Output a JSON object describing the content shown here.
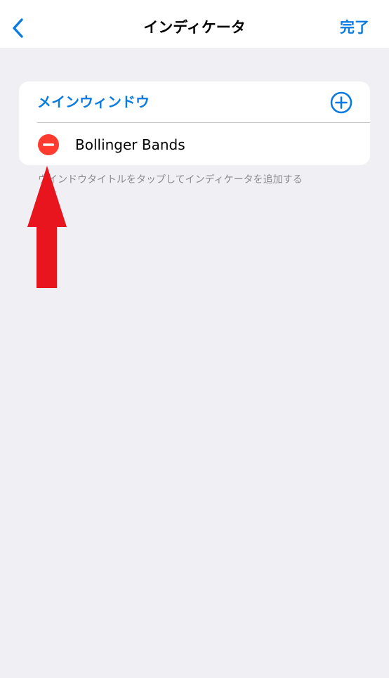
{
  "navbar": {
    "back_icon": "chevron-left-icon",
    "title": "インディケータ",
    "done_label": "完了"
  },
  "window_section": {
    "title": "メインウィンドウ",
    "add_icon": "plus-circle-icon",
    "indicators": [
      {
        "name": "Bollinger Bands",
        "remove_icon": "minus-circle-icon"
      }
    ]
  },
  "footer_hint": "ウインドウタイトルをタップしてインディケータを追加する",
  "annotation": {
    "arrow_icon": "up-arrow-icon"
  },
  "colors": {
    "accent": "#0a7be0",
    "background": "#f0eff4",
    "remove_red": "#ff3b30",
    "arrow_red": "#e8141e"
  }
}
